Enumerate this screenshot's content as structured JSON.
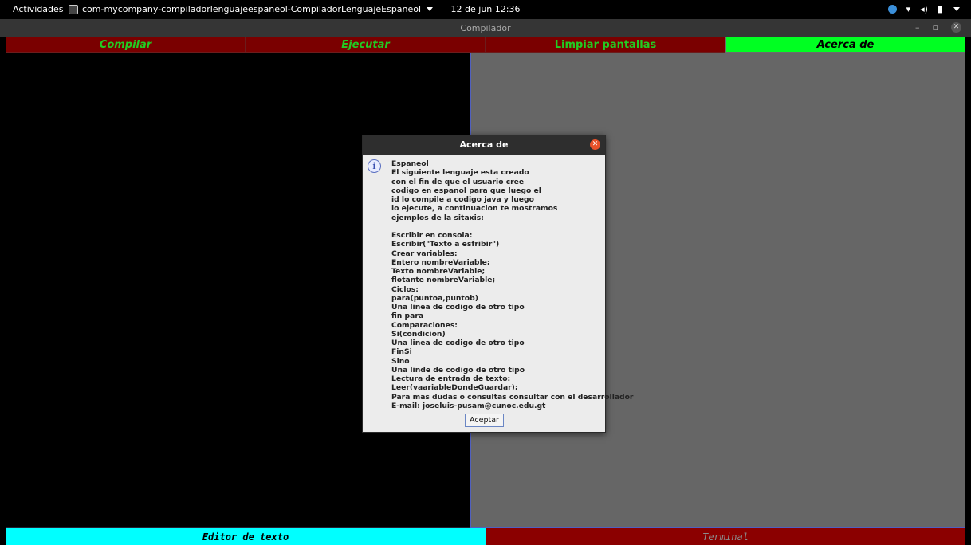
{
  "topbar": {
    "activities": "Actividades",
    "app_name": "com-mycompany-compiladorlenguajeespaneol-CompiladorLenguajeEspaneol",
    "clock": "12 de jun  12:36"
  },
  "window": {
    "title": "Compilador"
  },
  "menu": {
    "compilar": "Compilar",
    "ejecutar": "Ejecutar",
    "limpiar": "Limpiar pantallas",
    "acerca": "Acerca de"
  },
  "tabs": {
    "editor": "Editor de texto",
    "terminal": "Terminal"
  },
  "dialog": {
    "title": "Acerca de",
    "lines": [
      "Espaneol",
      "El siguiente lenguaje esta creado",
      "con el fin de que el usuario cree",
      "codigo en espanol para que luego el",
      "id lo compile a codigo java y luego",
      "lo ejecute, a continuacion te mostramos",
      "ejemplos de la sitaxis:",
      "",
      "Escribir en consola:",
      "Escribir(\"Texto a esfribir\")",
      "Crear variables:",
      "Entero nombreVariable;",
      "Texto nombreVariable;",
      "flotante nombreVariable;",
      "Ciclos:",
      "para(puntoa,puntob)",
      "Una linea de codigo de otro tipo",
      "fin para",
      "Comparaciones:",
      "Si(condicion)",
      "Una linea de codigo de otro tipo",
      "FinSi",
      "Sino",
      "Una linde de codigo de otro tipo",
      "Lectura de entrada de texto:",
      "Leer(vaariableDondeGuardar);",
      "Para mas dudas o consultas consultar con el desarrollador",
      "E-mail: joseluis-pusam@cunoc.edu.gt"
    ],
    "ok_button": "Aceptar"
  },
  "colors": {
    "menu_bg": "#7a0000",
    "menu_text": "#22cc22",
    "active_menu_bg": "#00ff22",
    "editor_tab_bg": "#00ffff",
    "terminal_tab_bg": "#8b0000",
    "terminal_bg": "#666666"
  }
}
